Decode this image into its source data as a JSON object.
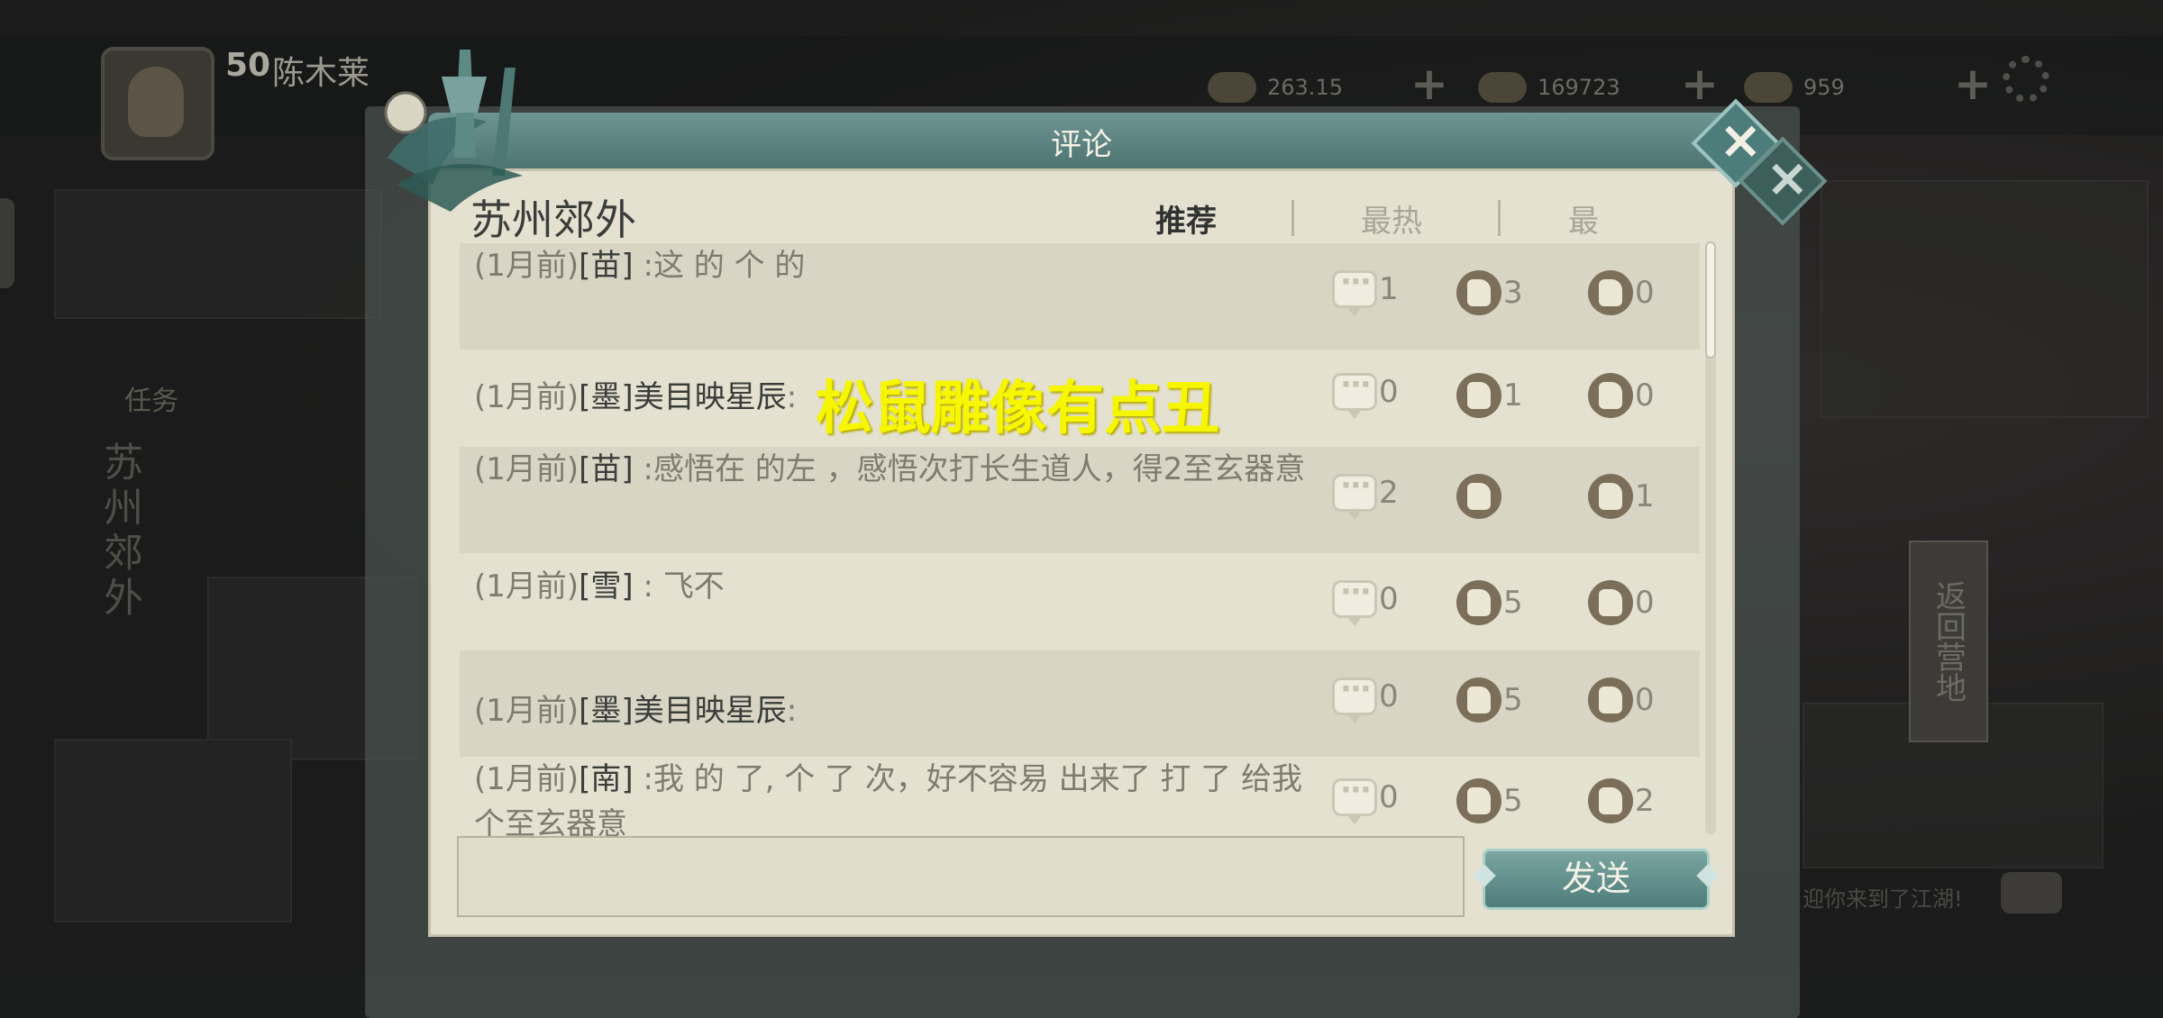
{
  "background": {
    "player_level": "50",
    "player_name": "陈木莱",
    "resources": [
      {
        "icon": "dumpling-icon",
        "value": "263.15"
      },
      {
        "icon": "ingot-icon",
        "value": "169723"
      },
      {
        "icon": "gold-icon",
        "value": "959"
      }
    ],
    "task_label": "任务",
    "left_vertical_label": "苏州郊外",
    "return_camp": "返回营地",
    "welcome_text": "迎你来到了江湖!"
  },
  "dialog": {
    "title": "评论",
    "location": "苏州郊外",
    "tabs": [
      {
        "label": "推荐",
        "active": true
      },
      {
        "label": "最热",
        "active": false
      },
      {
        "label": "最",
        "active": false
      }
    ],
    "comments": [
      {
        "time": "(1月前)",
        "author": "[苗]",
        "sep": "        :",
        "text": "这      的                    个       的",
        "replies": "1",
        "likes": "3",
        "dislikes": "0"
      },
      {
        "time": "(1月前)",
        "author": "[墨]美目映星辰",
        "sep": ":",
        "text": "",
        "replies": "0",
        "likes": "1",
        "dislikes": "0"
      },
      {
        "time": "(1月前)",
        "author": "[苗]",
        "sep": "        :",
        "text": "感悟在              的左            ，感悟次打长生道人，得2至玄器意",
        "replies": "2",
        "likes": "",
        "dislikes": "1"
      },
      {
        "time": "(1月前)",
        "author": "[雪]",
        "sep": "      :",
        "text": "          飞不",
        "replies": "0",
        "likes": "5",
        "dislikes": "0"
      },
      {
        "time": "(1月前)",
        "author": "[墨]美目映星辰",
        "sep": ":",
        "text": "",
        "replies": "0",
        "likes": "5",
        "dislikes": "0"
      },
      {
        "time": "(1月前)",
        "author": "[南]",
        "sep": "        :",
        "text": "我    的    了,     个          了  次，好不容易    出来了    打    了    给我    个至玄器意",
        "replies": "0",
        "likes": "5",
        "dislikes": "2"
      }
    ],
    "highlight_comment": "松鼠雕像有点丑",
    "input_placeholder": "",
    "send_label": "发送"
  }
}
